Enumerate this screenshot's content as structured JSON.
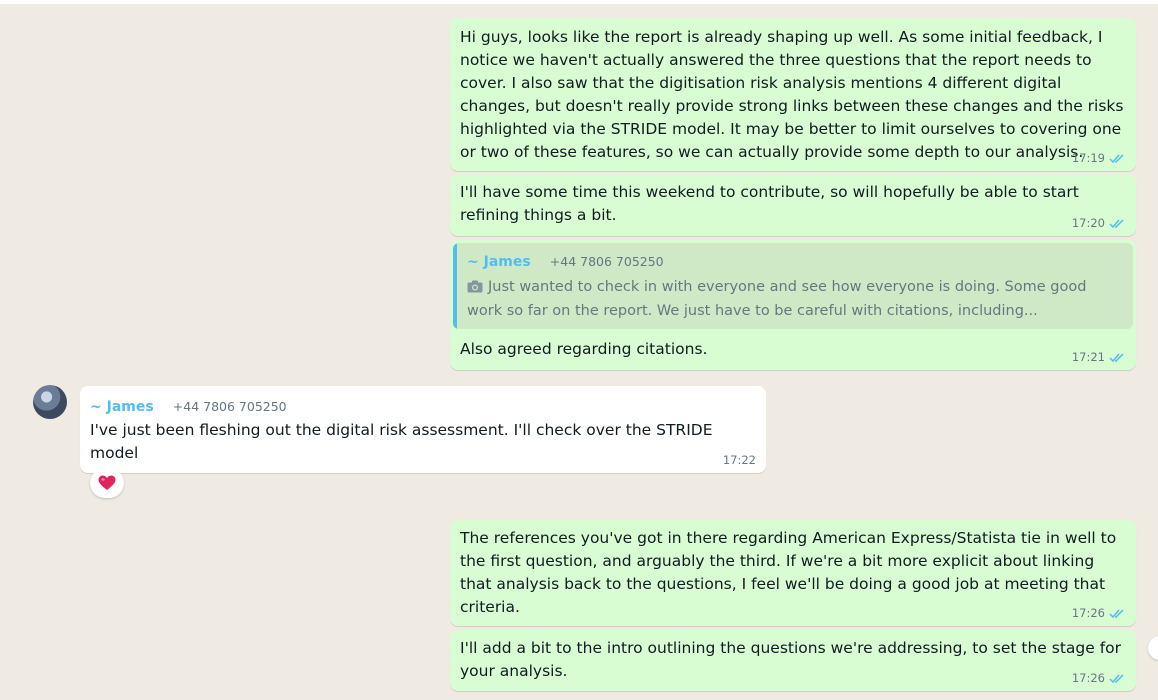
{
  "messages": {
    "m1": {
      "text": "Hi guys, looks like the report is already shaping up well. As some initial feedback, I notice we haven't actually answered the three questions that the report needs to cover. I also saw that the digitisation risk analysis mentions 4 different digital changes, but doesn't really provide strong links between these changes and the risks highlighted via the STRIDE model. It may be better to limit ourselves to covering one or two of these features, so we can actually provide some depth to our analysis.",
      "time": "17:19"
    },
    "m2": {
      "text": "I'll have some time this weekend to contribute, so will hopefully be able to start refining things a bit.",
      "time": "17:20"
    },
    "m3": {
      "quote": {
        "sender": "~ James",
        "phone": "+44 7806 705250",
        "photo_icon": "camera-icon",
        "text": "Just wanted to check in with everyone and see how everyone is doing. Some good work so far on the report. We just have to be careful with citations, including..."
      },
      "text": "Also agreed regarding citations.",
      "time": "17:21"
    },
    "m4": {
      "sender": "~ James",
      "phone": "+44 7806 705250",
      "text": "I've just been fleshing out the digital risk assessment. I'll check over the STRIDE model",
      "time": "17:22",
      "reaction": "heart-icon"
    },
    "m5": {
      "text": "The references you've got in there regarding American Express/Statista tie in well to the first question, and arguably the third. If we're a bit more explicit about linking that analysis back to the questions, I feel we'll be doing a good job at meeting that criteria.",
      "time": "17:26"
    },
    "m6": {
      "text": "I'll add a bit to the intro outlining the questions we're addressing, to set the stage for your analysis.",
      "time": "17:26"
    }
  },
  "colors": {
    "background": "#efeae2",
    "outgoing_bubble": "#d9fdd3",
    "incoming_bubble": "#ffffff",
    "sender_name": "#53bdeb",
    "read_ticks": "#53bdeb"
  }
}
